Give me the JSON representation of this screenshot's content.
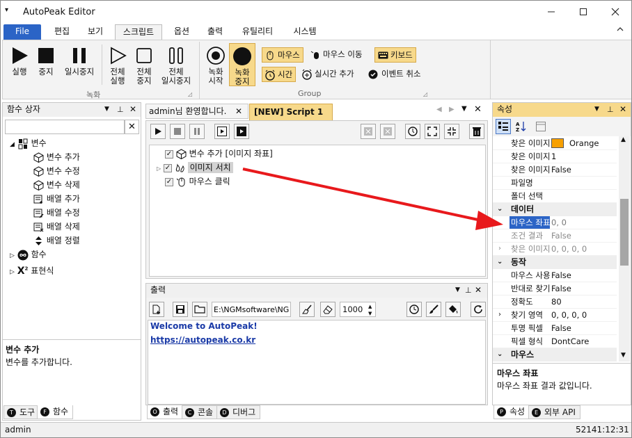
{
  "window": {
    "title": "AutoPeak Editor"
  },
  "ribbon_tabs": [
    "File",
    "편집",
    "보기",
    "스크립트",
    "옵션",
    "출력",
    "유틸리티",
    "시스템"
  ],
  "ribbon": {
    "record_group": {
      "label": "녹화",
      "buttons": [
        {
          "label1": "실행",
          "label2": ""
        },
        {
          "label1": "중지",
          "label2": ""
        },
        {
          "label1": "일시중지",
          "label2": ""
        },
        {
          "label1": "전체",
          "label2": "실행"
        },
        {
          "label1": "전체",
          "label2": "중지"
        },
        {
          "label1": "전체",
          "label2": "일시중지"
        }
      ]
    },
    "group2": {
      "label": "Group",
      "rec_start": {
        "label1": "녹화",
        "label2": "시작"
      },
      "rec_stop": {
        "label1": "녹화",
        "label2": "중지"
      },
      "mouse": "마우스",
      "mouse_move": "마우스 이동",
      "keyboard": "키보드",
      "time": "시간",
      "realtime_add": "실시간 추가",
      "event_cancel": "이벤트 취소"
    }
  },
  "function_box": {
    "title": "함수 상자",
    "search_value": "",
    "tree": {
      "variables": "변수",
      "items": [
        "변수 추가",
        "변수 수정",
        "변수 삭제",
        "배열 추가",
        "배열 수정",
        "배열 삭제",
        "배열 정렬"
      ],
      "functions": "함수",
      "expressions": "표현식"
    },
    "desc_title": "변수 추가",
    "desc_text": "변수를 추가합니다.",
    "tabs": [
      "도구",
      "함수"
    ],
    "tab_letters": [
      "T",
      "F"
    ]
  },
  "editor": {
    "tabs": [
      "admin님 환영합니다.",
      "[NEW] Script 1"
    ],
    "lines": [
      {
        "label": "변수 추가 [이미지 좌표]"
      },
      {
        "label": "이미지 서치"
      },
      {
        "label": "마우스 클릭"
      }
    ]
  },
  "output": {
    "title": "출력",
    "path": "E:\\NGMsoftware\\NG",
    "count": "1000",
    "welcome": "Welcome to AutoPeak!",
    "link": "https://autopeak.co.kr",
    "tabs": [
      "출력",
      "콘솔",
      "디버그"
    ],
    "tab_letters": [
      "O",
      "C",
      "D"
    ]
  },
  "properties": {
    "title": "속성",
    "rows_top": [
      {
        "key": "찾은 이미지",
        "value": "Orange",
        "swatch": "#f7a000"
      },
      {
        "key": "찾은 이미지",
        "value": "1"
      },
      {
        "key": "찾은 이미지",
        "value": "False"
      },
      {
        "key": "파일명",
        "value": ""
      },
      {
        "key": "폴더 선택",
        "value": ""
      }
    ],
    "cat_data": "데이터",
    "rows_data": [
      {
        "key": "마우스 좌표",
        "value": "0, 0"
      },
      {
        "key": "조건 결과",
        "value": "False"
      },
      {
        "key": "찾은 이미지",
        "value": "0, 0, 0, 0"
      }
    ],
    "cat_action": "동작",
    "rows_action": [
      {
        "key": "마우스 사용",
        "value": "False"
      },
      {
        "key": "반대로 찾기",
        "value": "False"
      },
      {
        "key": "정확도",
        "value": "80"
      },
      {
        "key": "찾기 영역",
        "value": "0, 0, 0, 0"
      },
      {
        "key": "투명 픽셀",
        "value": "False"
      },
      {
        "key": "픽셀 형식",
        "value": "DontCare"
      }
    ],
    "cat_mouse": "마우스",
    "desc_title": "마우스 좌표",
    "desc_text": "마우스 좌표 결과 값입니다.",
    "tabs": [
      "속성",
      "외부 API"
    ],
    "tab_letters": [
      "P",
      "E"
    ]
  },
  "status": {
    "user": "admin",
    "time": "52141:12:31"
  },
  "colors": {
    "accent": "#2b64c6",
    "arrow": "#e8191c",
    "highlight": "#f7d98b"
  }
}
